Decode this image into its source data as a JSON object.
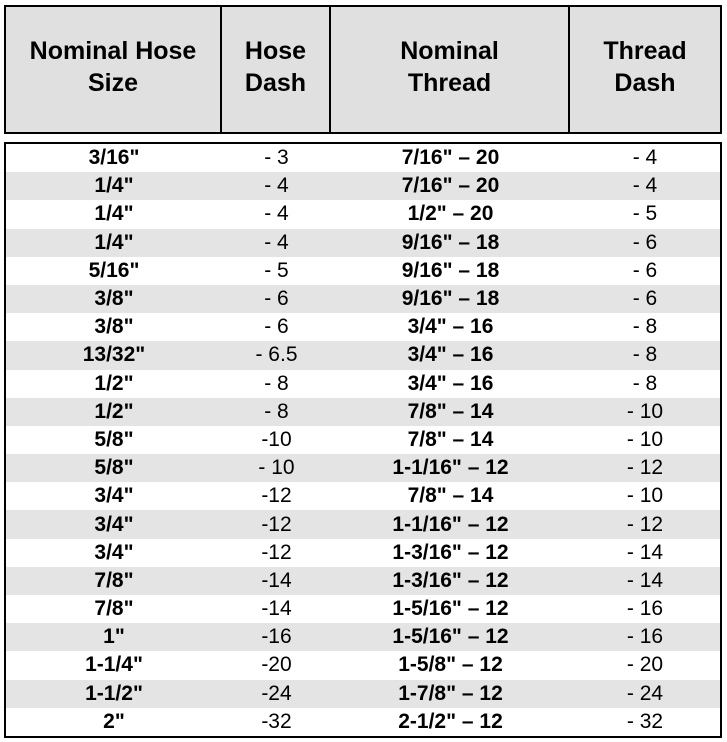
{
  "table": {
    "headers": [
      "Nominal Hose\nSize",
      "Hose\nDash",
      "Nominal\nThread",
      "Thread\nDash"
    ],
    "rows": [
      [
        "3/16\"",
        "- 3",
        "7/16\" – 20",
        "- 4"
      ],
      [
        "1/4\"",
        "- 4",
        "7/16\" – 20",
        "- 4"
      ],
      [
        "1/4\"",
        "- 4",
        "1/2\" – 20",
        "- 5"
      ],
      [
        "1/4\"",
        "- 4",
        "9/16\" – 18",
        "- 6"
      ],
      [
        "5/16\"",
        "- 5",
        "9/16\" – 18",
        "- 6"
      ],
      [
        "3/8\"",
        "- 6",
        "9/16\" – 18",
        "- 6"
      ],
      [
        "3/8\"",
        "- 6",
        "3/4\" – 16",
        "- 8"
      ],
      [
        "13/32\"",
        "- 6.5",
        "3/4\" – 16",
        "- 8"
      ],
      [
        "1/2\"",
        "- 8",
        "3/4\" – 16",
        "- 8"
      ],
      [
        "1/2\"",
        "- 8",
        "7/8\" – 14",
        "- 10"
      ],
      [
        "5/8\"",
        "-10",
        "7/8\" – 14",
        "- 10"
      ],
      [
        "5/8\"",
        "- 10",
        "1-1/16\" – 12",
        "- 12"
      ],
      [
        "3/4\"",
        "-12",
        "7/8\" – 14",
        "- 10"
      ],
      [
        "3/4\"",
        "-12",
        "1-1/16\" – 12",
        "- 12"
      ],
      [
        "3/4\"",
        "-12",
        "1-3/16\" – 12",
        "- 14"
      ],
      [
        "7/8\"",
        "-14",
        "1-3/16\" – 12",
        "- 14"
      ],
      [
        "7/8\"",
        "-14",
        "1-5/16\" – 12",
        "- 16"
      ],
      [
        "1\"",
        "-16",
        "1-5/16\" – 12",
        "- 16"
      ],
      [
        "1-1/4\"",
        "-20",
        "1-5/8\" – 12",
        "- 20"
      ],
      [
        "1-1/2\"",
        "-24",
        "1-7/8\" – 12",
        "- 24"
      ],
      [
        "2\"",
        "-32",
        "2-1/2\" – 12",
        "- 32"
      ]
    ]
  },
  "colors": {
    "header_bg": "#e0e0e0",
    "stripe_bg": "#e4e4e4",
    "border": "#000000"
  }
}
